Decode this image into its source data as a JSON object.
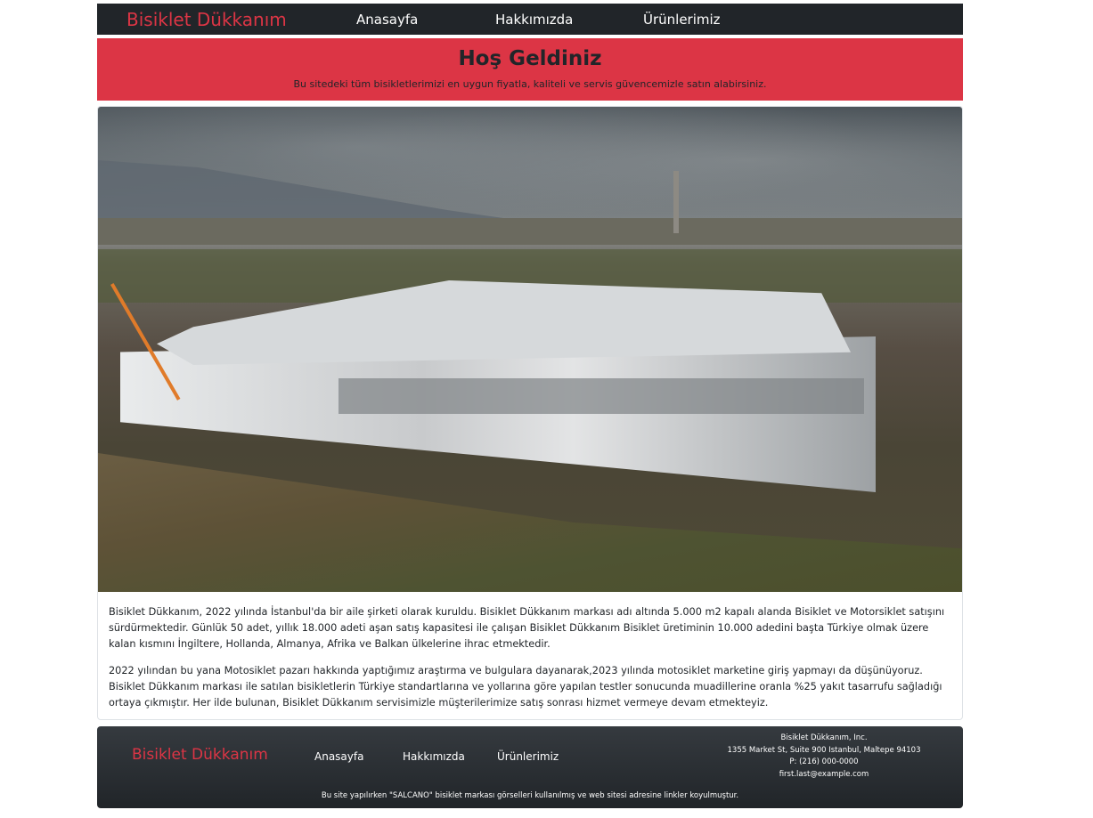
{
  "nav": {
    "brand": "Bisiklet Dükkanım",
    "links": [
      "Anasayfa",
      "Hakkımızda",
      "Ürünlerimiz"
    ]
  },
  "hero": {
    "title": "Hoş Geldiniz",
    "subtitle": "Bu sitedeki tüm bisikletlerimizi en uygun fiyatla, kaliteli ve servis güvencemizle satın alabirsiniz."
  },
  "content": {
    "image": "factory-aerial-photo",
    "paragraphs": [
      "Bisiklet Dükkanım, 2022 yılında İstanbul'da bir aile şirketi olarak kuruldu. Bisiklet Dükkanım markası adı altında 5.000 m2 kapalı alanda Bisiklet ve Motorsiklet satışını sürdürmektedir. Günlük 50 adet, yıllık 18.000 adeti aşan satış kapasitesi ile çalışan Bisiklet Dükkanım Bisiklet üretiminin 10.000 adedini başta Türkiye olmak üzere kalan kısmını İngiltere, Hollanda, Almanya, Afrika ve Balkan ülkelerine ihrac etmektedir.",
      "2022 yılından bu yana Motosiklet pazarı hakkında yaptığımız araştırma ve bulgulara dayanarak,2023 yılında motosiklet marketine giriş yapmayı da düşünüyoruz. Bisiklet Dükkanım markası ile satılan bisikletlerin Türkiye standartlarına ve yollarına göre yapılan testler sonucunda muadillerine oranla %25 yakıt tasarrufu sağladığı ortaya çıkmıştır. Her ilde bulunan, Bisiklet Dükkanım servisimizle müşterilerimize satış sonrası hizmet vermeye devam etmekteyiz."
    ]
  },
  "footer": {
    "brand": "Bisiklet Dükkanım",
    "links": [
      "Anasayfa",
      "Hakkımızda",
      "Ürünlerimiz"
    ],
    "address": {
      "company": "Bisiklet Dükkanım, Inc.",
      "street": "1355 Market St, Suite 900 Istanbul, Maltepe 94103",
      "phone": "P: (216) 000-0000",
      "email": "first.last@example.com"
    },
    "note": "Bu site yapılırken \"SALCANO\" bisiklet markası görselleri kullanılmış ve web sitesi adresine linkler koyulmuştur."
  },
  "colors": {
    "brand_red": "#dc3545",
    "dark": "#212529"
  }
}
